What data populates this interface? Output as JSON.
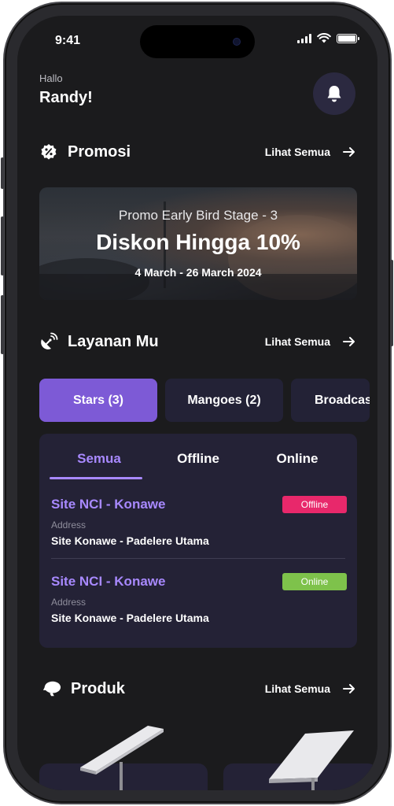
{
  "status_bar": {
    "time": "9:41"
  },
  "header": {
    "greeting": "Hallo",
    "name": "Randy!"
  },
  "promo_section": {
    "title": "Promosi",
    "see_all": "Lihat Semua",
    "banner": {
      "stage": "Promo Early Bird Stage - 3",
      "headline": "Diskon Hingga 10%",
      "dates": "4 March - 26 March 2024"
    }
  },
  "services_section": {
    "title": "Layanan Mu",
    "see_all": "Lihat Semua",
    "chips": [
      {
        "label": "Stars (3)",
        "active": true
      },
      {
        "label": "Mangoes (2)",
        "active": false
      },
      {
        "label": "Broadcas",
        "active": false
      }
    ],
    "subtabs": [
      {
        "label": "Semua",
        "active": true
      },
      {
        "label": "Offline",
        "active": false
      },
      {
        "label": "Online",
        "active": false
      }
    ],
    "sites": [
      {
        "name": "Site NCI - Konawe",
        "status": "Offline",
        "address_label": "Address",
        "address": "Site Konawe - Padelere Utama"
      },
      {
        "name": "Site NCI - Konawe",
        "status": "Online",
        "address_label": "Address",
        "address": "Site Konawe - Padelere Utama"
      }
    ]
  },
  "products_section": {
    "title": "Produk",
    "see_all": "Lihat Semua"
  },
  "colors": {
    "background": "#1b1b1d",
    "accent": "#7d5ad6",
    "accent_text": "#a889ff",
    "card": "#242236",
    "offline": "#e8286b",
    "online": "#7ec24b"
  }
}
